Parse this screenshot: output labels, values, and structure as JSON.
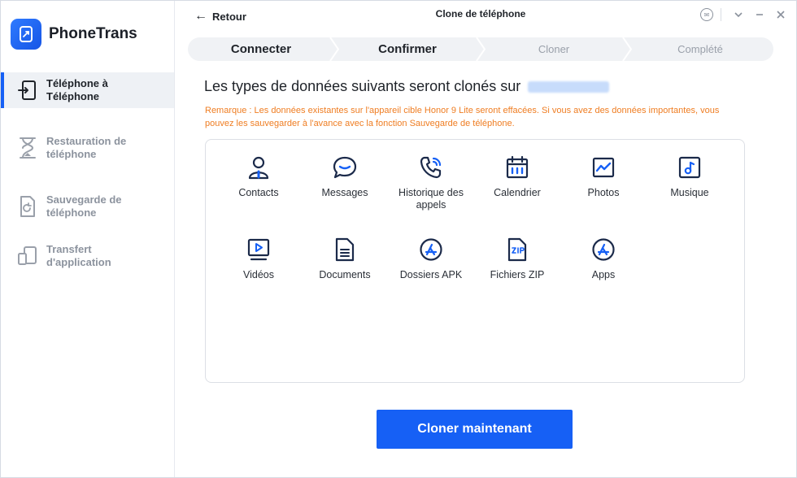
{
  "app": {
    "name": "PhoneTrans",
    "window_title": "Clone de téléphone"
  },
  "topbar": {
    "back_label": "Retour"
  },
  "sidebar": {
    "items": [
      {
        "label": "Téléphone à Téléphone",
        "icon": "phone-transfer-icon",
        "active": true
      },
      {
        "label": "Restauration de téléphone",
        "icon": "hourglass-icon",
        "active": false
      },
      {
        "label": "Sauvegarde de téléphone",
        "icon": "backup-icon",
        "active": false
      },
      {
        "label": "Transfert d'application",
        "icon": "app-transfer-icon",
        "active": false
      }
    ]
  },
  "stepper": {
    "steps": [
      {
        "label": "Connecter",
        "state": "done"
      },
      {
        "label": "Confirmer",
        "state": "current"
      },
      {
        "label": "Cloner",
        "state": "todo"
      },
      {
        "label": "Complété",
        "state": "todo"
      }
    ]
  },
  "main": {
    "heading": "Les types de données suivants seront clonés sur",
    "note": "Remarque : Les données existantes sur l'appareil cible Honor 9 Lite seront effacées. Si vous avez des données importantes, vous pouvez les sauvegarder à l'avance avec la fonction Sauvegarde de téléphone.",
    "data_types": [
      {
        "label": "Contacts",
        "icon": "contacts-icon"
      },
      {
        "label": "Messages",
        "icon": "messages-icon"
      },
      {
        "label": "Historique des appels",
        "icon": "call-history-icon"
      },
      {
        "label": "Calendrier",
        "icon": "calendar-icon"
      },
      {
        "label": "Photos",
        "icon": "photos-icon"
      },
      {
        "label": "Musique",
        "icon": "music-icon"
      },
      {
        "label": "Vidéos",
        "icon": "videos-icon"
      },
      {
        "label": "Documents",
        "icon": "documents-icon"
      },
      {
        "label": "Dossiers APK",
        "icon": "apk-icon"
      },
      {
        "label": "Fichiers ZIP",
        "icon": "zip-icon"
      },
      {
        "label": "Apps",
        "icon": "apps-icon"
      }
    ],
    "cta_label": "Cloner maintenant"
  },
  "colors": {
    "accent": "#1660f5",
    "warning": "#ef7d22",
    "icon": "#1b2a4a",
    "icon_accent": "#1660f5"
  }
}
